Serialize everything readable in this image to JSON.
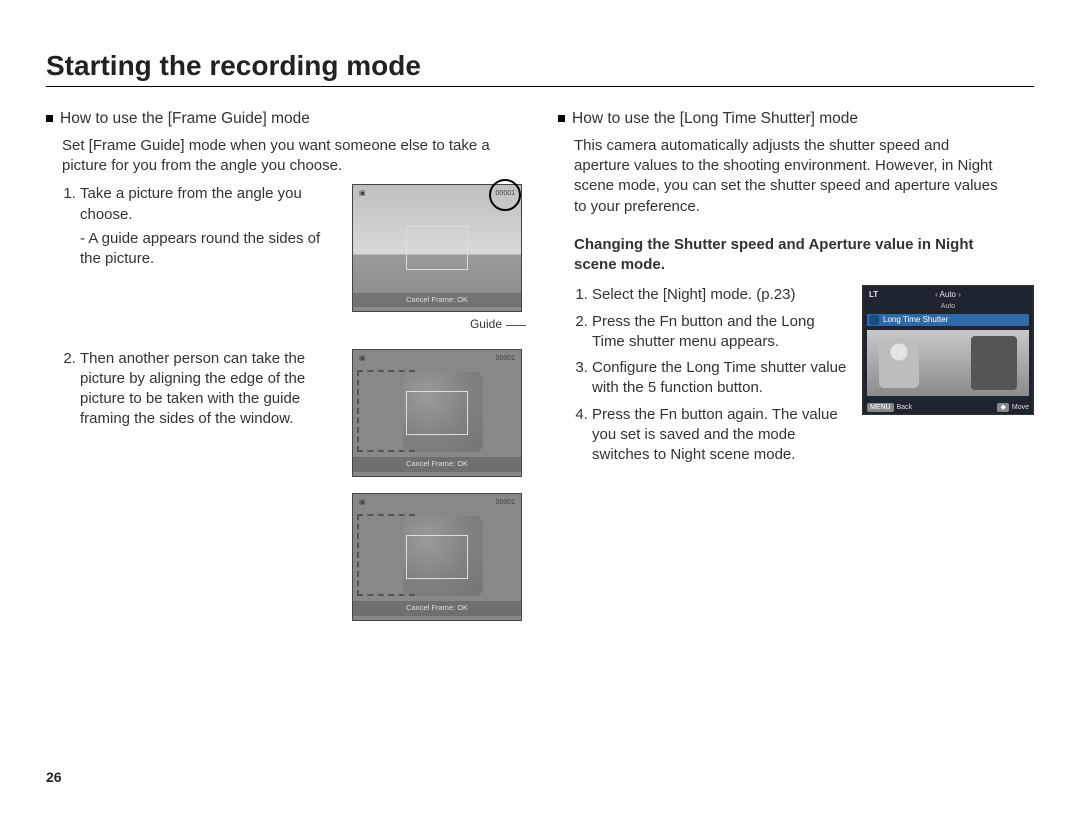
{
  "page_number": "26",
  "title": "Starting the recording mode",
  "left": {
    "subhead": "How to use the [Frame Guide] mode",
    "intro": "Set [Frame Guide] mode when you want someone else to take a picture for you from the angle you choose.",
    "step1": "Take a picture from the angle you choose.",
    "step1_note": "- A guide appears round the sides of the picture.",
    "guide_label": "Guide",
    "step2": "Then another person can take the picture by aligning the edge of the picture to be taken with the guide framing the sides of the window.",
    "thumb_osd_count": "00001",
    "thumb_osd_bottom": "Cancel Frame: OK"
  },
  "right": {
    "subhead": "How to use the [Long Time Shutter] mode",
    "intro": "This camera automatically adjusts the shutter speed and aperture values to the shooting environment. However, in Night scene mode, you can set the shutter speed and aperture values to your preference.",
    "bold_para": "Changing the Shutter speed and Aperture value in Night scene mode.",
    "steps": [
      "Select the [Night] mode. (p.23)",
      "Press the Fn button and the Long Time shutter menu appears.",
      "Configure the Long Time shutter value with the 5 function button.",
      "Press the Fn button again. The value you set is saved and the mode switches to Night scene mode."
    ],
    "lt": {
      "lt_label": "LT",
      "tab": "Auto",
      "tab_sub": "Auto",
      "bar_text": "Long Time Shutter",
      "foot_back_btn": "MENU",
      "foot_back": "Back",
      "foot_move_btn": "◆",
      "foot_move": "Move"
    }
  }
}
